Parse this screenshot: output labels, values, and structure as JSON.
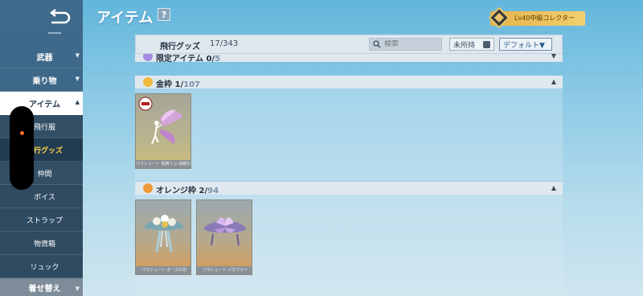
{
  "header": {
    "title": "アイテム",
    "help": "?",
    "rank_label": "Lv40中級コレクター"
  },
  "sidebar": {
    "items": [
      {
        "label": "武器"
      },
      {
        "label": "乗り物"
      },
      {
        "label": "アイテム"
      },
      {
        "label": "飛行服"
      },
      {
        "label": "飛行グッズ"
      },
      {
        "label": "仲間"
      },
      {
        "label": "ボイス"
      },
      {
        "label": "ストラップ"
      },
      {
        "label": "物資箱"
      },
      {
        "label": "リュック"
      },
      {
        "label": "着せ替え"
      }
    ]
  },
  "filter_bar": {
    "category": "飛行グッズ",
    "count": "17/343",
    "search_placeholder": "検索",
    "unowned_label": "未所持",
    "sort_label": "デフォルト▼"
  },
  "sections": [
    {
      "name": "限定アイテム",
      "owned": "0/",
      "total": "5",
      "toggle": "▼",
      "color": "#a58be0"
    },
    {
      "name": "金枠",
      "owned": "1/",
      "total": "107",
      "toggle": "▲",
      "color": "#f0b93a"
    },
    {
      "name": "オレンジ枠",
      "owned": "2/",
      "total": "94",
      "toggle": "▲",
      "color": "#f19a3a"
    }
  ],
  "cards": [
    {
      "caption": "パラシュート 桜舞うぶ 胡蝶の翅"
    },
    {
      "caption": "パラシュート オースの花"
    },
    {
      "caption": "パラシュート バタフライ"
    }
  ]
}
